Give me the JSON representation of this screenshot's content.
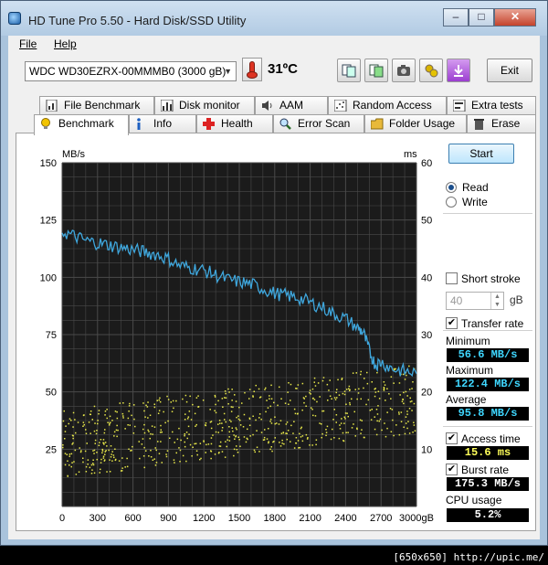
{
  "window": {
    "title": "HD Tune Pro 5.50 - Hard Disk/SSD Utility",
    "minimize": "–",
    "maximize": "□",
    "close": "✕"
  },
  "menu": {
    "file": "File",
    "help": "Help"
  },
  "toolbar": {
    "drive": "WDC WD30EZRX-00MMMB0 (3000 gB)",
    "temperature": "31ºC",
    "exit": "Exit",
    "icons": [
      "copy-icon",
      "copy-all-icon",
      "camera-icon",
      "options-icon",
      "save-icon"
    ]
  },
  "tabs_top": [
    "File Benchmark",
    "Disk monitor",
    "AAM",
    "Random Access",
    "Extra tests"
  ],
  "tabs_bottom": [
    "Benchmark",
    "Info",
    "Health",
    "Error Scan",
    "Folder Usage",
    "Erase"
  ],
  "side": {
    "start": "Start",
    "read": "Read",
    "write": "Write",
    "short_stroke": "Short stroke",
    "short_stroke_value": "40",
    "gb": "gB",
    "transfer_rate": "Transfer rate",
    "minimum_label": "Minimum",
    "minimum": "56.6 MB/s",
    "maximum_label": "Maximum",
    "maximum": "122.4 MB/s",
    "average_label": "Average",
    "average": "95.8 MB/s",
    "access_time": "Access time",
    "access_value": "15.6 ms",
    "burst_rate": "Burst rate",
    "burst_value": "175.3 MB/s",
    "cpu_usage": "CPU usage",
    "cpu_value": "5.2%"
  },
  "watermark": "[650x650] http://upic.me/",
  "chart_data": {
    "type": "line",
    "y_left_label": "MB/s",
    "y_right_label": "ms",
    "y_left_ticks": [
      25,
      50,
      75,
      100,
      125,
      150
    ],
    "y_right_ticks": [
      10,
      20,
      30,
      40,
      50,
      60
    ],
    "x_ticks": [
      "0",
      "300",
      "600",
      "900",
      "1200",
      "1500",
      "1800",
      "2100",
      "2400",
      "2700",
      "3000gB"
    ],
    "xlim": [
      0,
      3000
    ],
    "ylim_left": [
      0,
      150
    ],
    "ylim_right": [
      0,
      60
    ],
    "grid": true,
    "colors": {
      "transfer": "#3fa7dd",
      "access": "#e8e84a",
      "background": "#1b1b1b",
      "grid": "#4a4a4a"
    },
    "series": [
      {
        "name": "Transfer rate",
        "x": [
          0,
          100,
          200,
          300,
          400,
          500,
          600,
          700,
          800,
          900,
          1000,
          1100,
          1200,
          1300,
          1400,
          1500,
          1600,
          1700,
          1800,
          1900,
          2000,
          2100,
          2200,
          2300,
          2400,
          2500,
          2550,
          2600,
          2650,
          2700,
          2800,
          2900,
          3000
        ],
        "y": [
          120,
          118,
          116,
          115,
          114,
          113,
          112,
          111,
          110,
          108,
          105,
          104,
          103,
          101,
          99,
          98,
          97,
          95,
          93,
          92,
          91,
          89,
          87,
          84,
          82,
          78,
          76,
          68,
          62,
          63,
          60,
          59,
          58
        ]
      }
    ],
    "access_time_ms": {
      "min": 5,
      "max": 28,
      "typical": 15.6
    }
  }
}
